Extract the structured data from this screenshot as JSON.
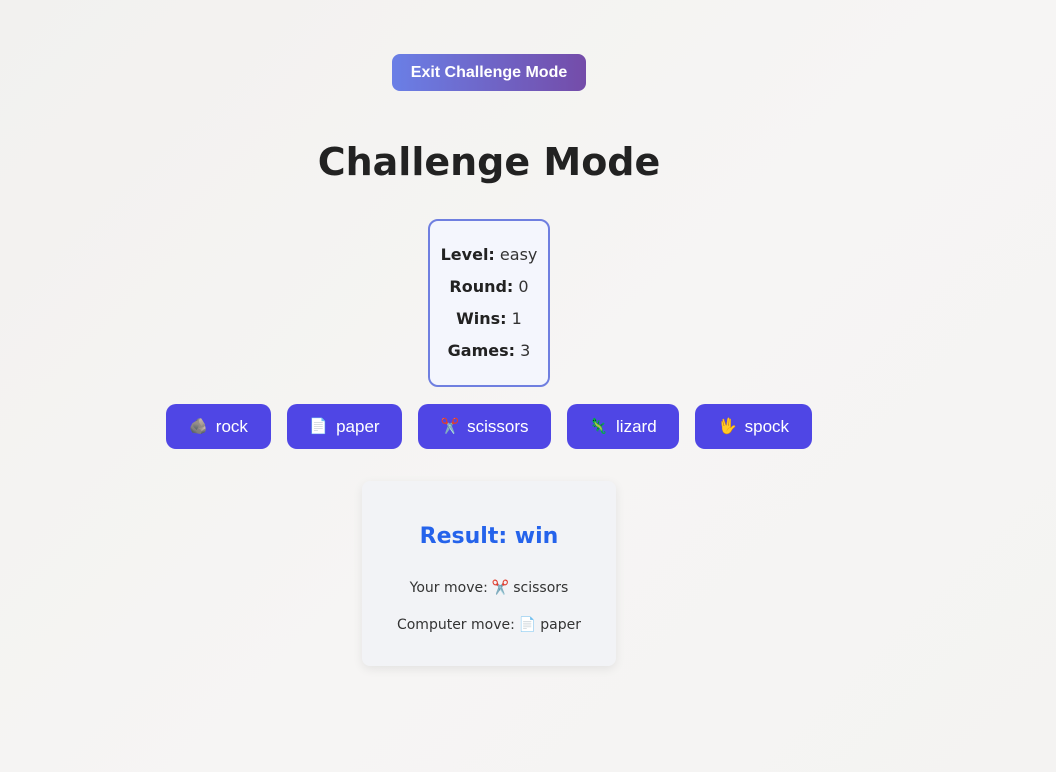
{
  "header": {
    "exit_label": "Exit Challenge Mode",
    "title": "Challenge Mode"
  },
  "stats": {
    "level_label": "Level:",
    "level_value": "easy",
    "round_label": "Round:",
    "round_value": "0",
    "wins_label": "Wins:",
    "wins_value": "1",
    "games_label": "Games:",
    "games_value": "3"
  },
  "moves": [
    {
      "label": "rock",
      "icon": "🪨",
      "icon_name": "rock-icon"
    },
    {
      "label": "paper",
      "icon": "📄",
      "icon_name": "paper-icon"
    },
    {
      "label": "scissors",
      "icon": "✂️",
      "icon_name": "scissors-icon"
    },
    {
      "label": "lizard",
      "icon": "🦎",
      "icon_name": "lizard-icon"
    },
    {
      "label": "spock",
      "icon": "🖖",
      "icon_name": "spock-hand-icon"
    }
  ],
  "result": {
    "title": "Result: win",
    "your_move_label": "Your move:",
    "your_move_icon": "✂️",
    "your_move_value": "scissors",
    "computer_move_label": "Computer move:",
    "computer_move_icon": "📄",
    "computer_move_value": "paper"
  },
  "colors": {
    "button_bg": "#4f46e5",
    "exit_gradient_start": "#6a7fe6",
    "exit_gradient_end": "#744ca9",
    "result_color": "#2563eb",
    "stats_border": "#6f7fe0"
  }
}
